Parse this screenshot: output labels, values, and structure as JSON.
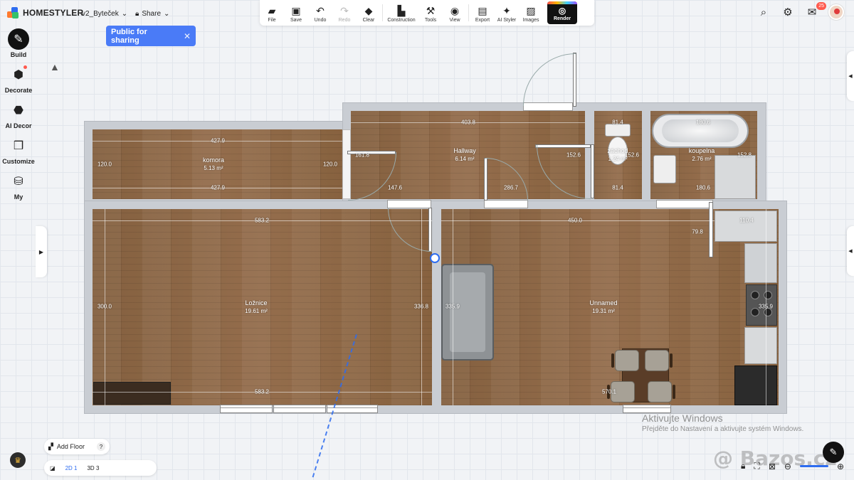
{
  "app": {
    "name": "HOMESTYLER",
    "project_name": "v2_Byteček",
    "share_label": "Share"
  },
  "sharing_popup": {
    "label": "Public for sharing",
    "close": "✕"
  },
  "toolbar": {
    "file": "File",
    "save": "Save",
    "undo": "Undo",
    "redo": "Redo",
    "clear": "Clear",
    "construction": "Construction",
    "tools": "Tools",
    "view": "View",
    "export": "Export",
    "ai_styler": "AI Styler",
    "images": "Images",
    "render": "Render"
  },
  "topright": {
    "notifications_count": "25"
  },
  "leftnav": {
    "build": "Build",
    "decorate": "Decorate",
    "ai_decor": "AI Decor",
    "customize": "Customize",
    "my": "My"
  },
  "rooms": {
    "komora": {
      "name": "komora",
      "area": "5.13 m²"
    },
    "hallway": {
      "name": "Hallway",
      "area": "6.14 m²"
    },
    "zachod": {
      "name": "záchod",
      "area": "1.24 m²"
    },
    "koupelna": {
      "name": "koupelna",
      "area": "2.76 m²"
    },
    "loznice": {
      "name": "Ložnice",
      "area": "19.61 m²"
    },
    "unnamed": {
      "name": "Unnamed",
      "area": "19.31 m²"
    }
  },
  "dimensions": {
    "komora_top": "427.9",
    "komora_bottom": "427.9",
    "komora_left": "120.0",
    "komora_right": "120.0",
    "hallway_top": "403.8",
    "hallway_left_a": "161.8",
    "hallway_bottom_a": "147.6",
    "hallway_bottom_b": "286.7",
    "hallway_right": "152.6",
    "zachod_top": "81.4",
    "zachod_bottom": "81.4",
    "zachod_right": "152.6",
    "koupelna_top": "180.6",
    "koupelna_bottom": "180.6",
    "koupelna_right": "152.8",
    "loznice_top": "583.2",
    "loznice_bottom": "583.2",
    "loznice_left": "300.0",
    "loznice_right": "336.8",
    "living_top": "450.0",
    "living_left": "335.9",
    "living_right": "335.9",
    "living_bottom": "570.1",
    "kitchen_a": "110.4",
    "kitchen_b": "79.8"
  },
  "bottom": {
    "add_floor": "Add Floor",
    "help": "?",
    "view_2d": "2D",
    "view_2d_count": "1",
    "view_3d": "3D",
    "view_3d_count": "3"
  },
  "overlay": {
    "activate_title": "Aktivujte Windows",
    "activate_sub": "Přejděte do Nastavení a aktivujte systém Windows.",
    "watermark": "@ Bazos.cz"
  },
  "colors": {
    "accent": "#4a7bf7",
    "floor": "#8a6546",
    "wall": "#c9cdd3",
    "badge": "#ff5a4e"
  },
  "icons": {
    "file": "folder-icon",
    "save": "save-icon",
    "undo": "undo-icon",
    "redo": "redo-icon",
    "clear": "eraser-icon",
    "construction": "construction-icon",
    "tools": "tools-icon",
    "view": "eye-icon",
    "export": "export-icon",
    "ai_styler": "ai-styler-icon",
    "images": "images-icon",
    "render": "camera-icon"
  }
}
